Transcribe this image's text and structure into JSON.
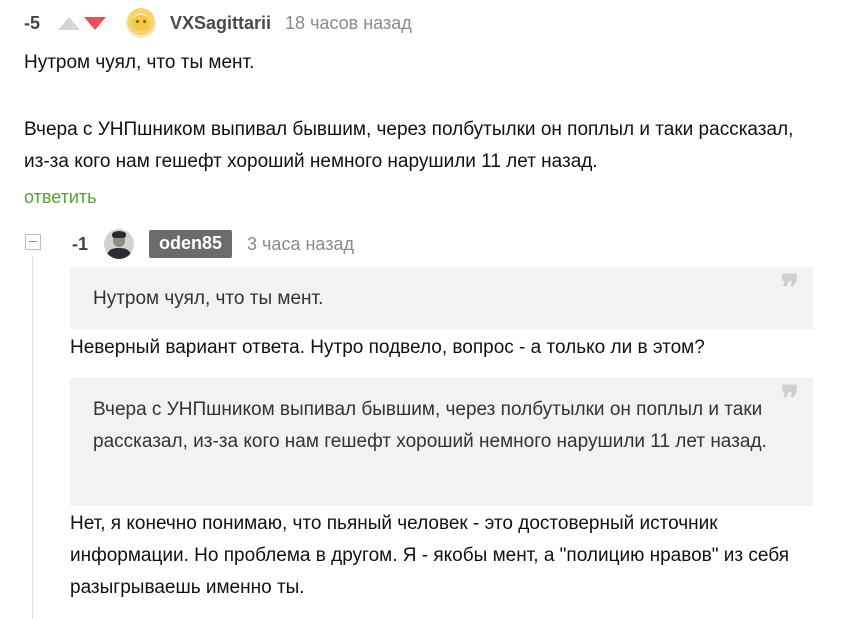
{
  "comment_1": {
    "rating": "-5",
    "username": "VXSagittarii",
    "time": "18 часов назад",
    "paragraph_1": "Нутром чуял, что ты мент.",
    "paragraph_2": "Вчера с УНПшником выпивал бывшим, через полбутылки он поплыл и таки рассказал, из-за кого нам гешефт хороший немного нарушили 11 лет назад.",
    "reply_label": "ответить",
    "avatar_icon": "sun-avatar-icon"
  },
  "comment_2": {
    "rating": "-1",
    "username": "oden85",
    "time": "3 часа назад",
    "quote_1": "Нутром чуял, что ты мент.",
    "text_1": "Неверный вариант ответа. Нутро подвело, вопрос - а только ли в этом?",
    "quote_2": "Вчера с УНПшником выпивал бывшим, через полбутылки он поплыл и таки рассказал, из-за кого нам гешефт хороший немного нарушили 11 лет назад.",
    "text_2": "Нет, я конечно понимаю, что пьяный человек - это достоверный источник информации. Но проблема в другом. Я - якобы мент, а \"полицию нравов\" из себя разыгрываешь именно ты.",
    "quote_mark": "❞",
    "avatar_icon": "user-photo-avatar-icon"
  },
  "colors": {
    "vote_down": "#e8505b",
    "vote_up": "#d6d6d6",
    "reply_link": "#5e9c3a",
    "username_badge": "#6b6b6b",
    "quote_background": "#f2f2f2"
  }
}
